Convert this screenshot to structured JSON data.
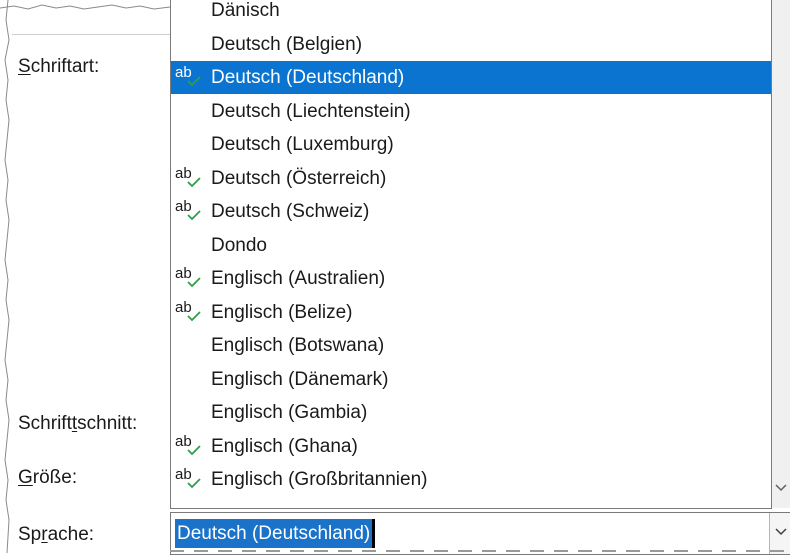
{
  "labels": {
    "font": "Schriftart:",
    "font_style_pre": "Schrift",
    "font_style_u": "t",
    "font_style_post": "schnitt:",
    "size_u": "G",
    "size_post": "röße:",
    "language_pre": "Sp",
    "language_u": "r",
    "language_post": "ache:",
    "font_u": "S",
    "font_post": "chriftart:"
  },
  "spell_glyph": "ab",
  "languages": [
    {
      "label": "Dänisch",
      "spell": false,
      "selected": false
    },
    {
      "label": "Deutsch (Belgien)",
      "spell": false,
      "selected": false
    },
    {
      "label": "Deutsch (Deutschland)",
      "spell": true,
      "selected": true
    },
    {
      "label": "Deutsch (Liechtenstein)",
      "spell": false,
      "selected": false
    },
    {
      "label": "Deutsch (Luxemburg)",
      "spell": false,
      "selected": false
    },
    {
      "label": "Deutsch (Österreich)",
      "spell": true,
      "selected": false
    },
    {
      "label": "Deutsch (Schweiz)",
      "spell": true,
      "selected": false
    },
    {
      "label": "Dondo",
      "spell": false,
      "selected": false
    },
    {
      "label": "Englisch (Australien)",
      "spell": true,
      "selected": false
    },
    {
      "label": "Englisch (Belize)",
      "spell": true,
      "selected": false
    },
    {
      "label": "Englisch (Botswana)",
      "spell": false,
      "selected": false
    },
    {
      "label": "Englisch (Dänemark)",
      "spell": false,
      "selected": false
    },
    {
      "label": "Englisch (Gambia)",
      "spell": false,
      "selected": false
    },
    {
      "label": "Englisch (Ghana)",
      "spell": true,
      "selected": false
    },
    {
      "label": "Englisch (Großbritannien)",
      "spell": true,
      "selected": false
    }
  ],
  "combo": {
    "value": "Deutsch (Deutschland)"
  },
  "icons": {
    "spell": "spellcheck-icon",
    "dropdown": "chevron-down-icon",
    "scroll_down": "scroll-down-icon"
  },
  "colors": {
    "selection": "#0a74d0",
    "check": "#2e9e4a"
  }
}
